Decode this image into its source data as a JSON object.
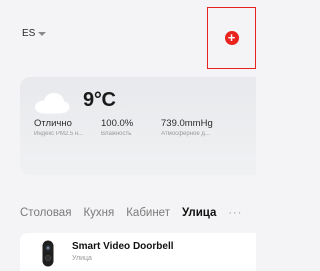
{
  "header": {
    "home_name": "ES",
    "add_icon": "plus-circle-icon",
    "accent_color": "#e8231f"
  },
  "weather": {
    "icon": "cloud-icon",
    "temperature": "9°C",
    "metrics": [
      {
        "value": "Отлично",
        "label": "Индекс PM2.5 н..."
      },
      {
        "value": "100.0%",
        "label": "Влажность"
      },
      {
        "value": "739.0mmHg",
        "label": "Атмосферное д..."
      }
    ]
  },
  "rooms": {
    "tabs": [
      "Столовая",
      "Кухня",
      "Кабинет",
      "Улица"
    ],
    "active": "Улица",
    "more_label": "···"
  },
  "devices": [
    {
      "name": "Smart Video Doorbell",
      "room": "Улица",
      "icon": "doorbell-icon"
    }
  ]
}
